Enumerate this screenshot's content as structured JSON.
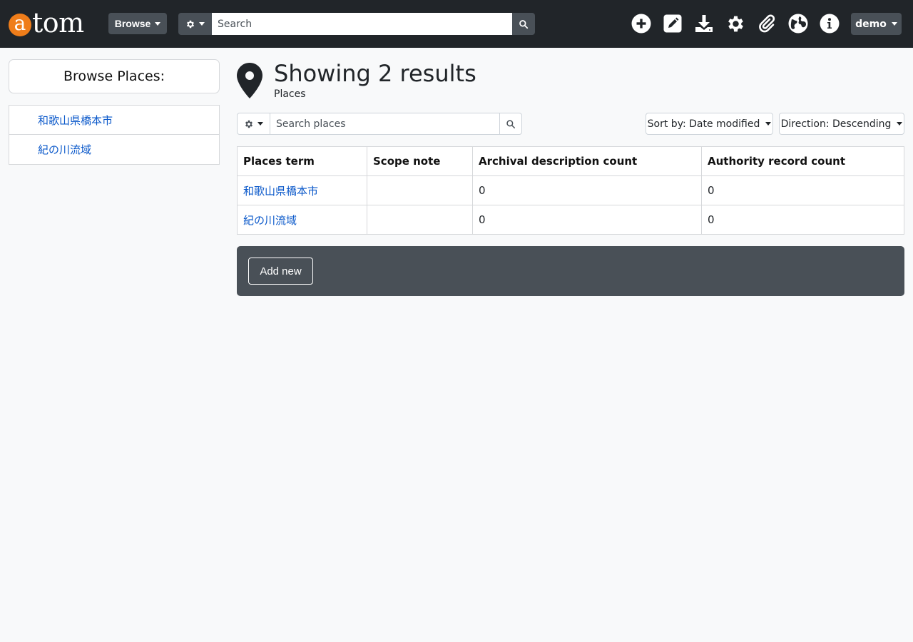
{
  "navbar": {
    "logo_first": "a",
    "logo_rest": "tom",
    "browse_label": "Browse",
    "search_placeholder": "Search",
    "user_label": "demo",
    "icons": [
      "add-icon",
      "edit-icon",
      "import-icon",
      "settings-icon",
      "clipboard-icon",
      "language-icon",
      "info-icon"
    ]
  },
  "sidebar": {
    "title": "Browse Places:",
    "items": [
      {
        "label": "和歌山県橋本市"
      },
      {
        "label": "紀の川流域"
      }
    ]
  },
  "heading": {
    "title": "Showing 2 results",
    "subtitle": "Places"
  },
  "controls": {
    "search_placeholder": "Search places",
    "sort_label": "Sort by: Date modified",
    "direction_label": "Direction: Descending"
  },
  "table": {
    "headers": [
      "Places term",
      "Scope note",
      "Archival description count",
      "Authority record count"
    ],
    "rows": [
      {
        "term": "和歌山県橋本市",
        "scope": "",
        "archival": "0",
        "authority": "0"
      },
      {
        "term": "紀の川流域",
        "scope": "",
        "archival": "0",
        "authority": "0"
      }
    ]
  },
  "actions": {
    "add_label": "Add new"
  },
  "colors": {
    "navbar_bg": "#212529",
    "logo_accent": "#ef7d1a",
    "link": "#0a58ca",
    "action_bar": "#495057"
  }
}
